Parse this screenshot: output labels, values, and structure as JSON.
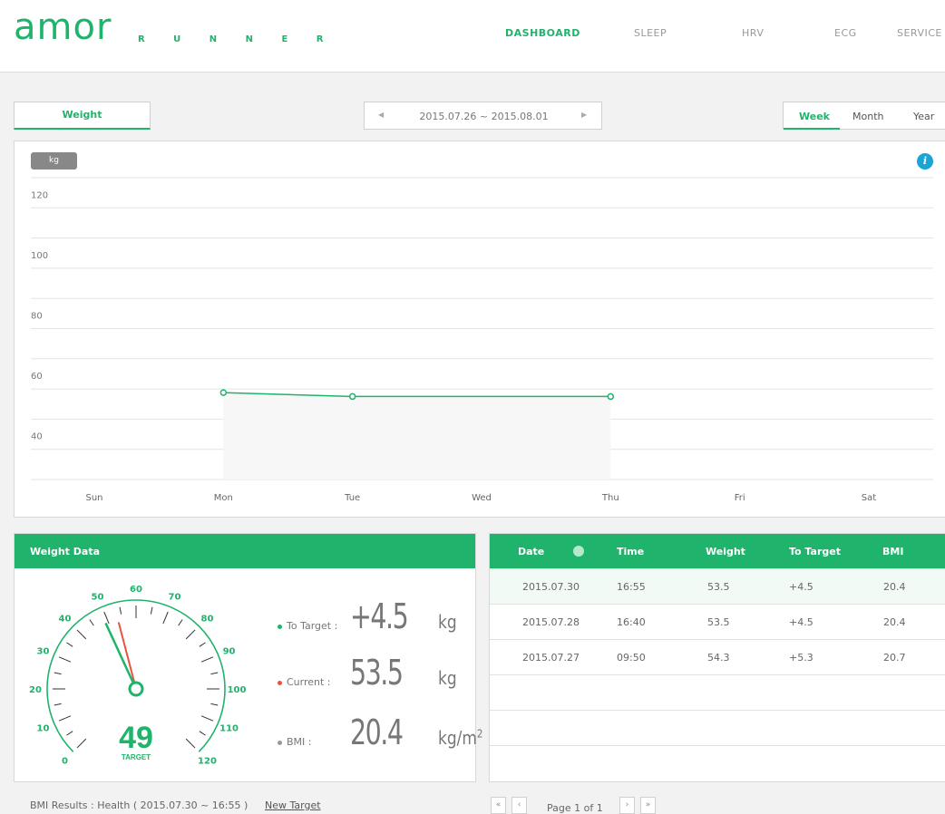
{
  "brand": {
    "logo": "amor",
    "sub": "R U N N E R"
  },
  "nav": [
    "DASHBOARD",
    "SLEEP",
    "HRV",
    "ECG",
    "SERVICE"
  ],
  "weight_tab": "Weight",
  "date_range": "2015.07.26 ~ 2015.08.01",
  "period": {
    "week": "Week",
    "month": "Month",
    "year": "Year"
  },
  "chart_data": {
    "type": "line",
    "ylabel": "kg",
    "ylim": [
      30,
      130
    ],
    "yticks": [
      "120",
      "100",
      "80",
      "60",
      "40"
    ],
    "categories": [
      "Sun",
      "Mon",
      "Tue",
      "Wed",
      "Thu",
      "Fri",
      "Sat"
    ],
    "series": [
      {
        "values": [
          null,
          58.8,
          57.5,
          null,
          57.5,
          null,
          null
        ]
      }
    ],
    "grid": true
  },
  "info_icon": "i",
  "weight_data": {
    "title": "Weight Data",
    "gauge": {
      "ticks": [
        "0",
        "10",
        "20",
        "30",
        "40",
        "50",
        "60",
        "70",
        "80",
        "90",
        "100",
        "110",
        "120"
      ],
      "target_value": "49",
      "target_label": "TARGET"
    },
    "to_target_label": "To Target :",
    "to_target_value": "+4.5",
    "to_target_unit": "kg",
    "current_label": "Current :",
    "current_value": "53.5",
    "current_unit": "kg",
    "bmi_label": "BMI :",
    "bmi_value": "20.4",
    "bmi_unit": "kg/m",
    "bmi_unit_sup": "2",
    "colors": {
      "to_target": "#1fb36b",
      "current": "#e8533f",
      "bmi": "#999999"
    }
  },
  "table": {
    "headers": [
      "Date",
      "Time",
      "Weight",
      "To Target",
      "BMI"
    ],
    "rows": [
      [
        "2015.07.30",
        "16:55",
        "53.5",
        "+4.5",
        "20.4"
      ],
      [
        "2015.07.28",
        "16:40",
        "53.5",
        "+4.5",
        "20.4"
      ],
      [
        "2015.07.27",
        "09:50",
        "54.3",
        "+5.3",
        "20.7"
      ]
    ]
  },
  "footer": {
    "bmi_result": "BMI Results : Health ( 2015.07.30 ~ 16:55 )",
    "new_target": "New Target"
  },
  "pagination": {
    "first": "«",
    "prev": "‹",
    "text": "Page 1 of 1",
    "next": "›",
    "last": "»"
  },
  "theme": {
    "accent": "#1fb36b",
    "info": "#1aa5d6"
  }
}
